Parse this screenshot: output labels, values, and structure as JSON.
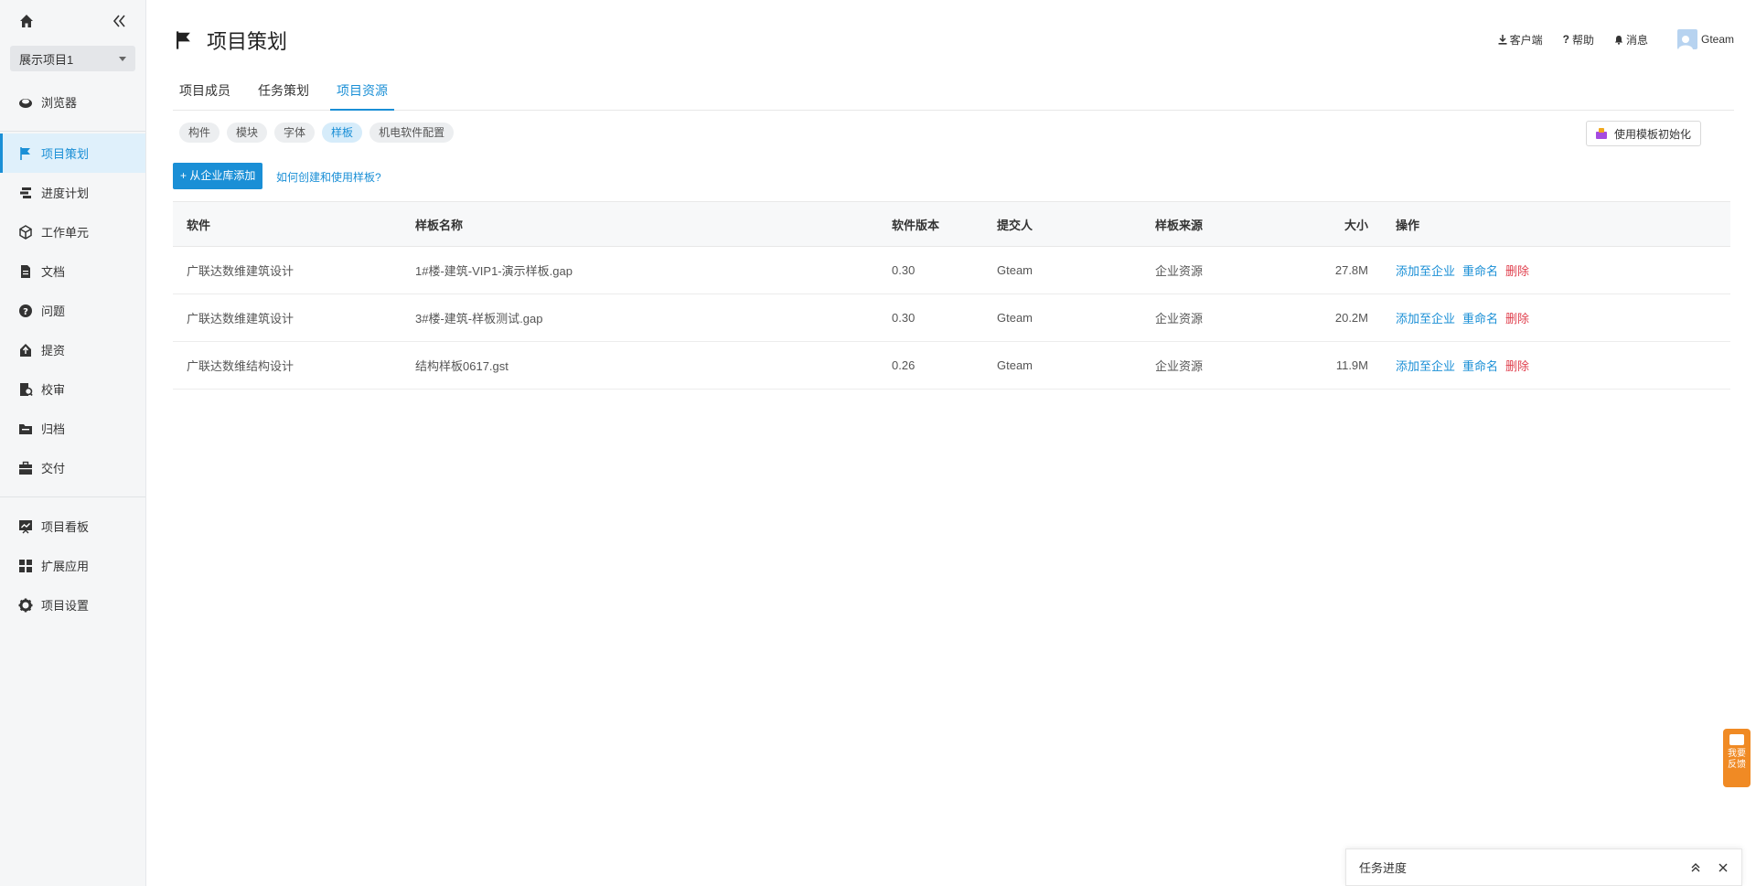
{
  "sidebar": {
    "project_name": "展示项目1",
    "items": [
      {
        "label": "浏览器",
        "icon": "browser-icon"
      },
      {
        "label": "项目策划",
        "icon": "flag-icon"
      },
      {
        "label": "进度计划",
        "icon": "gantt-icon"
      },
      {
        "label": "工作单元",
        "icon": "cube-icon"
      },
      {
        "label": "文档",
        "icon": "document-icon"
      },
      {
        "label": "问题",
        "icon": "question-icon"
      },
      {
        "label": "提资",
        "icon": "submit-icon"
      },
      {
        "label": "校审",
        "icon": "review-icon"
      },
      {
        "label": "归档",
        "icon": "archive-icon"
      },
      {
        "label": "交付",
        "icon": "briefcase-icon"
      },
      {
        "label": "项目看板",
        "icon": "dashboard-icon"
      },
      {
        "label": "扩展应用",
        "icon": "apps-icon"
      },
      {
        "label": "项目设置",
        "icon": "gear-icon"
      }
    ]
  },
  "header": {
    "title": "项目策划",
    "client_label": "客户端",
    "help_label": "帮助",
    "messages_label": "消息",
    "user_name": "Gteam"
  },
  "tabs": [
    "项目成员",
    "任务策划",
    "项目资源"
  ],
  "chips": [
    "构件",
    "模块",
    "字体",
    "样板",
    "机电软件配置"
  ],
  "actions": {
    "init_button": "使用模板初始化",
    "add_button": "+ 从企业库添加",
    "help_link": "如何创建和使用样板?"
  },
  "table": {
    "headers": [
      "软件",
      "样板名称",
      "软件版本",
      "提交人",
      "样板来源",
      "大小",
      "操作"
    ],
    "rows": [
      {
        "software": "广联达数维建筑设计",
        "name": "1#楼-建筑-VIP1-演示样板.gap",
        "version": "0.30",
        "submitter": "Gteam",
        "source": "企业资源",
        "size": "27.8M"
      },
      {
        "software": "广联达数维建筑设计",
        "name": "3#楼-建筑-样板测试.gap",
        "version": "0.30",
        "submitter": "Gteam",
        "source": "企业资源",
        "size": "20.2M"
      },
      {
        "software": "广联达数维结构设计",
        "name": "结构样板0617.gst",
        "version": "0.26",
        "submitter": "Gteam",
        "source": "企业资源",
        "size": "11.9M"
      }
    ],
    "row_actions": {
      "add": "添加至企业",
      "rename": "重命名",
      "delete": "删除"
    }
  },
  "feedback": {
    "line1": "我要",
    "line2": "反馈"
  },
  "task_panel": {
    "label": "任务进度"
  },
  "colors": {
    "accent": "#1a8fd6",
    "danger": "#e0414f",
    "feedback": "#f08a24"
  }
}
